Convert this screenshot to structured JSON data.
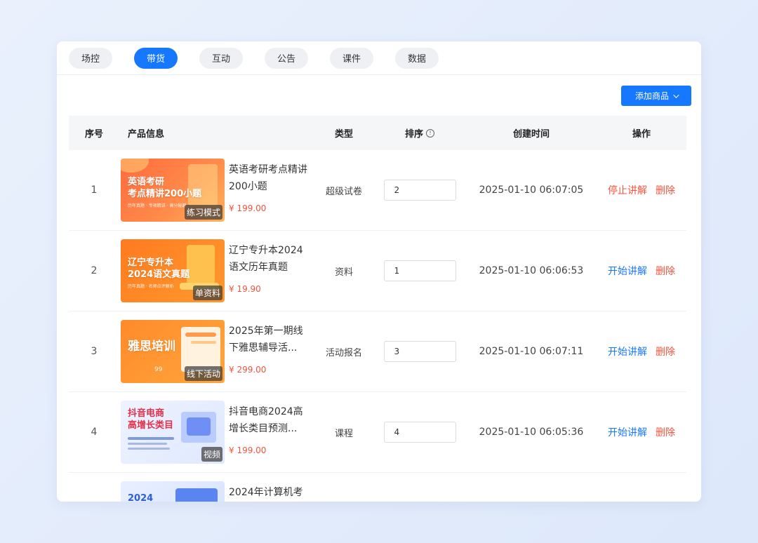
{
  "tabs": [
    {
      "label": "场控"
    },
    {
      "label": "带货"
    },
    {
      "label": "互动"
    },
    {
      "label": "公告"
    },
    {
      "label": "课件"
    },
    {
      "label": "数据"
    }
  ],
  "toolbar": {
    "add_label": "添加商品"
  },
  "table": {
    "headers": {
      "index": "序号",
      "product": "产品信息",
      "type": "类型",
      "sort": "排序",
      "created": "创建时间",
      "actions": "操作"
    },
    "rows": [
      {
        "index": "1",
        "name": "英语考研考点精讲200小题",
        "price": "¥ 199.00",
        "type": "超级试卷",
        "sort": "2",
        "created": "2025-01-10 06:07:05",
        "primary_action": "停止讲解",
        "delete": "删除",
        "thumb": {
          "title": "英语考研\n考点精讲200小题",
          "sub": "历年真题 · 专项精讲 · 高分秘籍",
          "badge": "练习模式"
        }
      },
      {
        "index": "2",
        "name": "辽宁专升本2024语文历年真题",
        "price": "¥ 19.90",
        "type": "资料",
        "sort": "1",
        "created": "2025-01-10 06:06:53",
        "primary_action": "开始讲解",
        "delete": "删除",
        "thumb": {
          "title": "辽宁专升本\n2024语文真题",
          "sub": "历年真题 · 名师点评解析",
          "badge": "单资料"
        }
      },
      {
        "index": "3",
        "name": "2025年第一期线下雅思辅导活...",
        "price": "¥ 299.00",
        "type": "活动报名",
        "sort": "3",
        "created": "2025-01-10 06:07:11",
        "primary_action": "开始讲解",
        "delete": "删除",
        "thumb": {
          "title": "雅思培训",
          "sub": "99",
          "badge": "线下活动"
        }
      },
      {
        "index": "4",
        "name": "抖音电商2024高增长类目预测...",
        "price": "¥ 199.00",
        "type": "课程",
        "sort": "4",
        "created": "2025-01-10 06:05:36",
        "primary_action": "开始讲解",
        "delete": "删除",
        "thumb": {
          "title": "抖音电商\n高增长类目",
          "sub": "",
          "badge": "视频"
        }
      },
      {
        "index": "",
        "name": "2024年计算机考",
        "price": "",
        "type": "",
        "sort": "",
        "created": "",
        "primary_action": "",
        "delete": "",
        "thumb": {
          "title": "2024",
          "sub": "",
          "badge": ""
        }
      }
    ]
  },
  "colors": {
    "accent": "#1677ff",
    "danger": "#f5533d"
  }
}
